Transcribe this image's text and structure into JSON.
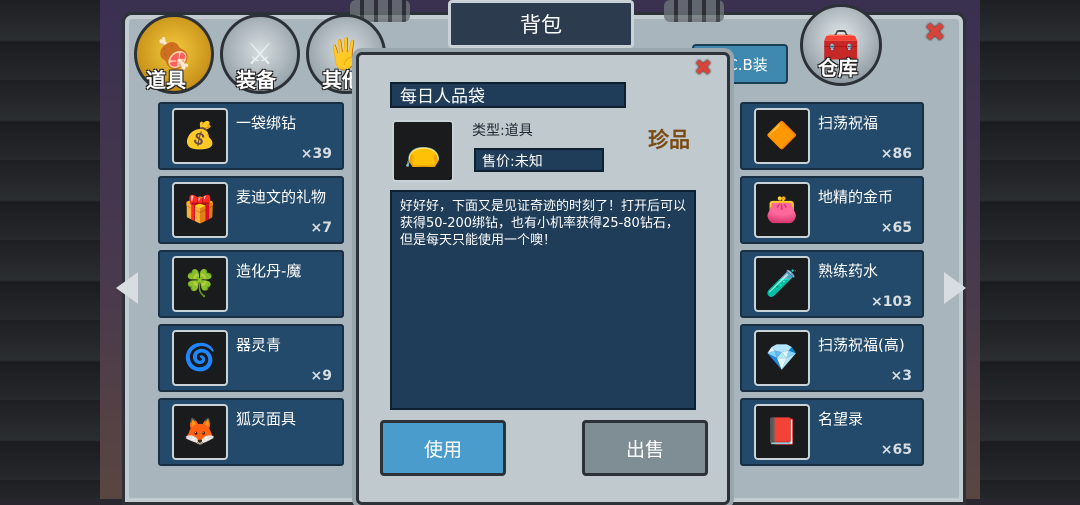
{
  "window": {
    "title": "背包"
  },
  "tabs": [
    {
      "label": "道具",
      "icon": "item-pouch-icon",
      "active": true
    },
    {
      "label": "装备",
      "icon": "sword-shield-icon",
      "active": false
    },
    {
      "label": "其他",
      "icon": "misc-icon",
      "active": false
    }
  ],
  "warehouse": {
    "label": "仓库",
    "icon": "chest-icon"
  },
  "sell_cb": {
    "label": "卖C.B装"
  },
  "left_items": [
    {
      "name": "一袋绑钻",
      "count": "×39",
      "icon": "diamond-bag-icon"
    },
    {
      "name": "麦迪文的礼物",
      "count": "×7",
      "icon": "gift-box-icon"
    },
    {
      "name": "造化丹-魔",
      "count": "",
      "icon": "pill-icon"
    },
    {
      "name": "器灵青",
      "count": "×9",
      "icon": "spirit-orb-icon"
    },
    {
      "name": "狐灵面具",
      "count": "",
      "icon": "fox-mask-icon"
    }
  ],
  "right_items": [
    {
      "name": "扫荡祝福",
      "count": "×86",
      "icon": "crystal-icon"
    },
    {
      "name": "地精的金币",
      "count": "×65",
      "icon": "coin-pouch-icon"
    },
    {
      "name": "熟练药水",
      "count": "×103",
      "icon": "potion-icon"
    },
    {
      "name": "扫荡祝福(高)",
      "count": "×3",
      "icon": "crystal-high-icon"
    },
    {
      "name": "名望录",
      "count": "×65",
      "icon": "book-icon"
    }
  ],
  "detail": {
    "title": "每日人品袋",
    "type": "类型:道具",
    "rarity": "珍品",
    "price": "售价:未知",
    "description": "好好好，下面又是见证奇迹的时刻了！打开后可以获得50-200绑钻，也有小机率获得25-80钻石，但是每天只能使用一个噢！",
    "icon": "lucky-bag-icon",
    "use_label": "使用",
    "sell_label": "出售"
  },
  "colors": {
    "accent": "#4a9ccc",
    "close": "#d8443a",
    "rarity": "#7a4a12"
  }
}
